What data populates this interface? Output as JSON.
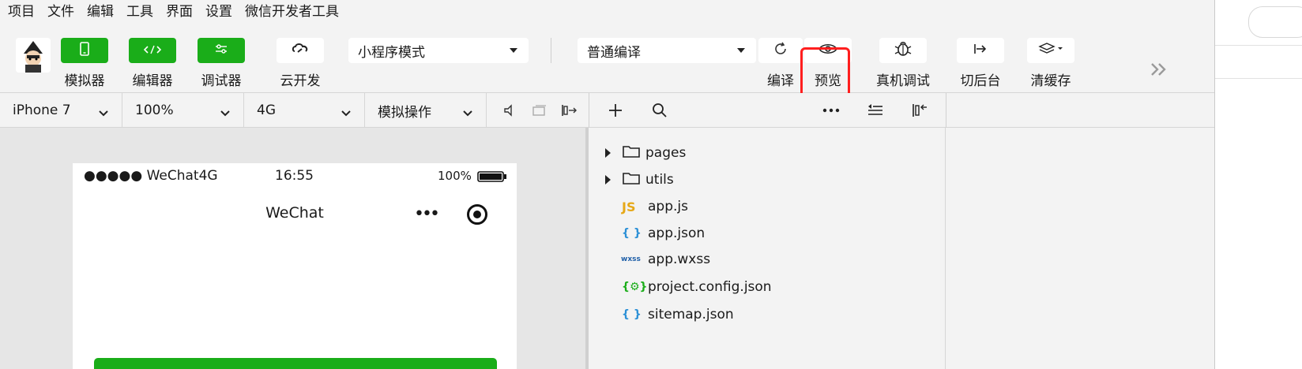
{
  "menu": [
    "项目",
    "文件",
    "编辑",
    "工具",
    "界面",
    "设置",
    "微信开发者工具"
  ],
  "toolbar": {
    "simulator_label": "模拟器",
    "editor_label": "编辑器",
    "debugger_label": "调试器",
    "cloud_label": "云开发",
    "mode_select": "小程序模式",
    "compile_select": "普通编译",
    "compile_label": "编译",
    "preview_label": "预览",
    "realdevice_label": "真机调试",
    "background_label": "切后台",
    "clearcache_label": "清缓存",
    "more_icon": "double-chevron-right-icon"
  },
  "subbar": {
    "device": "iPhone 7",
    "zoom": "100%",
    "network": "4G",
    "sim_ops": "模拟操作"
  },
  "phone": {
    "signal": "●●●●● WeChat4G",
    "time": "16:55",
    "battery": "100%",
    "nav_title": "WeChat",
    "capsule_dots": "•••"
  },
  "files": [
    {
      "name": "pages",
      "type": "folder"
    },
    {
      "name": "utils",
      "type": "folder"
    },
    {
      "name": "app.js",
      "type": "js",
      "icon": "JS"
    },
    {
      "name": "app.json",
      "type": "json",
      "icon": "{ }"
    },
    {
      "name": "app.wxss",
      "type": "wxss",
      "icon": "wxss"
    },
    {
      "name": "project.config.json",
      "type": "config",
      "icon": "{⚙}"
    },
    {
      "name": "sitemap.json",
      "type": "json",
      "icon": "{ }"
    }
  ],
  "colors": {
    "accent_green": "#1aad19",
    "highlight_red": "#ff1e1e",
    "js_icon": "#e6a817",
    "json_icon": "#2a8fd6",
    "wxss_icon": "#1f5fa8",
    "config_icon": "#1aad19"
  }
}
